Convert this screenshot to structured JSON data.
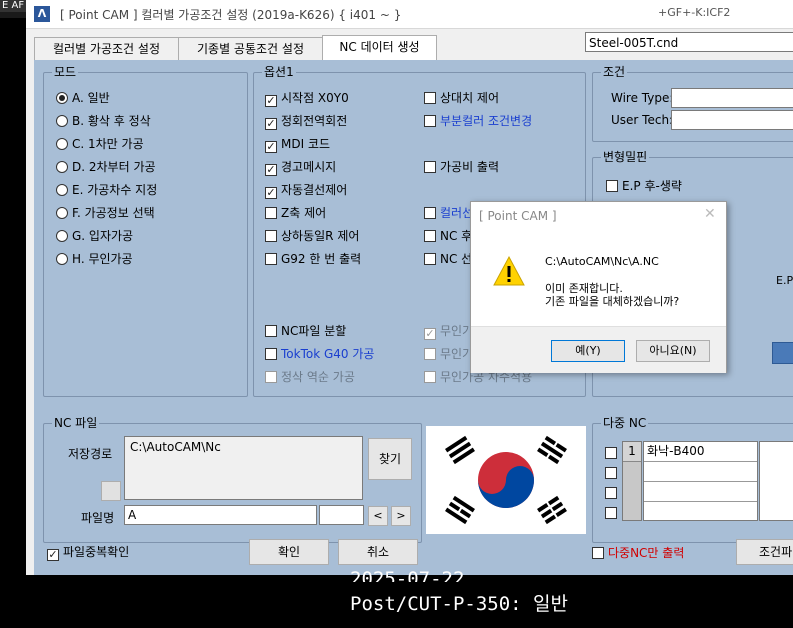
{
  "background": {
    "left_label": "E AF"
  },
  "window": {
    "title": "[ Point CAM ]  컬러별 가공조건 설정  (2019a-K626)    { i401 ~ }",
    "title_right": "+GF+-K:ICF2",
    "tabs": [
      "컬러별 가공조건 설정",
      "기종별 공통조건 설정",
      "NC 데이터 생성"
    ],
    "file_name": "Steel-005T.cnd"
  },
  "mode": {
    "label": "모드",
    "options": [
      "A. 일반",
      "B. 황삭 후 정삭",
      "C. 1차만 가공",
      "D. 2차부터 가공",
      "E. 가공차수 지정",
      "F. 가공정보 선택",
      "G. 입자가공",
      "H. 무인가공"
    ],
    "selected": 0
  },
  "options1": {
    "label": "옵션1",
    "left": [
      {
        "label": "시작점 X0Y0",
        "checked": true
      },
      {
        "label": "정회전역회전",
        "checked": true
      },
      {
        "label": "MDI 코드",
        "checked": true
      },
      {
        "label": "경고메시지",
        "checked": true
      },
      {
        "label": "자동결선제어",
        "checked": true
      },
      {
        "label": "Z축 제어",
        "checked": false
      },
      {
        "label": "상하동일R 제어",
        "checked": false
      },
      {
        "label": "G92 한 번 출력",
        "checked": false
      }
    ],
    "right": [
      {
        "label": "상대치 제어",
        "checked": false
      },
      {
        "label": "부분컬러 조건변경",
        "checked": false
      },
      {
        "label": "가공비 출력",
        "checked": false
      },
      {
        "label": "컬러선",
        "checked": false
      },
      {
        "label": "NC 후",
        "checked": false
      },
      {
        "label": "NC 선",
        "checked": false
      }
    ],
    "bottom_left": [
      {
        "label": "NC파일 분할",
        "checked": false
      },
      {
        "label": "TokTok  G40 가공",
        "checked": false
      },
      {
        "label": "정삭 역순 가공",
        "checked": false
      }
    ],
    "bottom_right": [
      {
        "label": "무인가",
        "checked": true
      },
      {
        "label": "무인가",
        "checked": false
      },
      {
        "label": "무인가공 차수적용",
        "checked": false
      }
    ]
  },
  "condition": {
    "label": "조건",
    "wire_type": "Wire Type:",
    "user_tech": "User Tech:"
  },
  "deform": {
    "label": "변형밀핀",
    "ep_item": "E.P 후-생략",
    "ep_partial": "E.P"
  },
  "ncfile": {
    "label": "NC 파일",
    "save_path_label": "저장경로",
    "save_path": "C:\\AutoCAM\\Nc",
    "find_label": "찾기",
    "filename_label": "파일명",
    "filename": "A",
    "prev": "<",
    "next": ">",
    "dup_check": "파일중복확인"
  },
  "multi_nc": {
    "label": "다중 NC",
    "rows": [
      {
        "num": "1",
        "name": "화낙-B400"
      },
      {
        "num": "",
        "name": ""
      },
      {
        "num": "",
        "name": ""
      },
      {
        "num": "",
        "name": ""
      }
    ],
    "multi_only": "다중NC만 출력",
    "cond_btn": "조건파"
  },
  "buttons": {
    "ok": "확인",
    "cancel": "취소"
  },
  "dialog": {
    "title": "[ Point CAM ]",
    "path": "C:\\AutoCAM\\Nc\\A.NC",
    "line1": "이미 존재합니다.",
    "line2": "기존 파일을 대체하겠습니까?",
    "yes": "예(Y)",
    "no": "아니요(N)"
  },
  "bottom": {
    "date": "2025-07-22",
    "post": "Post/CUT-P-350: 일반"
  },
  "colors": {
    "panel": "#a8bed6",
    "link_blue": "#1a3fcf",
    "flag_red": "#cd2e3a",
    "flag_blue": "#0047a0"
  }
}
